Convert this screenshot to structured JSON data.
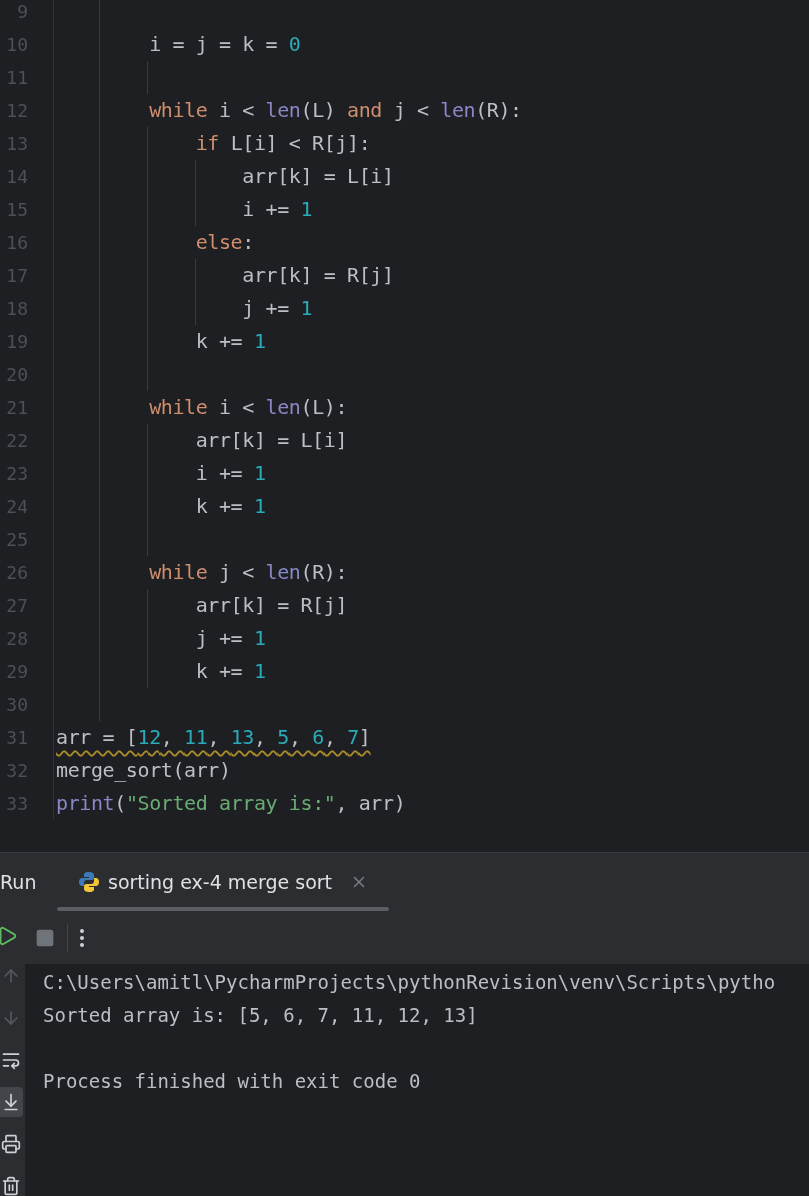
{
  "editor": {
    "lines": [
      {
        "number": "9"
      },
      {
        "number": "10",
        "warning": false,
        "tokens": [
          {
            "kind": "plain",
            "text": "        i = j = k = "
          },
          {
            "kind": "num",
            "text": "0"
          }
        ]
      },
      {
        "number": "11"
      },
      {
        "number": "12",
        "warning": false,
        "tokens": [
          {
            "kind": "kw",
            "text": "        while"
          },
          {
            "kind": "plain",
            "text": " i < "
          },
          {
            "kind": "fn",
            "text": "len"
          },
          {
            "kind": "plain",
            "text": "(L) "
          },
          {
            "kind": "kw",
            "text": "and"
          },
          {
            "kind": "plain",
            "text": " j < "
          },
          {
            "kind": "fn",
            "text": "len"
          },
          {
            "kind": "plain",
            "text": "(R):"
          }
        ]
      },
      {
        "number": "13",
        "warning": false,
        "tokens": [
          {
            "kind": "kw",
            "text": "            if"
          },
          {
            "kind": "plain",
            "text": " L[i] < R[j]:"
          }
        ]
      },
      {
        "number": "14",
        "warning": false,
        "tokens": [
          {
            "kind": "plain",
            "text": "                arr[k] = L[i]"
          }
        ]
      },
      {
        "number": "15",
        "warning": false,
        "tokens": [
          {
            "kind": "plain",
            "text": "                i += "
          },
          {
            "kind": "num",
            "text": "1"
          }
        ]
      },
      {
        "number": "16",
        "warning": false,
        "tokens": [
          {
            "kind": "kw",
            "text": "            else"
          },
          {
            "kind": "plain",
            "text": ":"
          }
        ]
      },
      {
        "number": "17",
        "warning": false,
        "tokens": [
          {
            "kind": "plain",
            "text": "                arr[k] = R[j]"
          }
        ]
      },
      {
        "number": "18",
        "warning": false,
        "tokens": [
          {
            "kind": "plain",
            "text": "                j += "
          },
          {
            "kind": "num",
            "text": "1"
          }
        ]
      },
      {
        "number": "19",
        "warning": false,
        "tokens": [
          {
            "kind": "plain",
            "text": "            k += "
          },
          {
            "kind": "num",
            "text": "1"
          }
        ]
      },
      {
        "number": "20"
      },
      {
        "number": "21",
        "warning": false,
        "tokens": [
          {
            "kind": "kw",
            "text": "        while"
          },
          {
            "kind": "plain",
            "text": " i < "
          },
          {
            "kind": "fn",
            "text": "len"
          },
          {
            "kind": "plain",
            "text": "(L):"
          }
        ]
      },
      {
        "number": "22",
        "warning": false,
        "tokens": [
          {
            "kind": "plain",
            "text": "            arr[k] = L[i]"
          }
        ]
      },
      {
        "number": "23",
        "warning": false,
        "tokens": [
          {
            "kind": "plain",
            "text": "            i += "
          },
          {
            "kind": "num",
            "text": "1"
          }
        ]
      },
      {
        "number": "24",
        "warning": false,
        "tokens": [
          {
            "kind": "plain",
            "text": "            k += "
          },
          {
            "kind": "num",
            "text": "1"
          }
        ]
      },
      {
        "number": "25"
      },
      {
        "number": "26",
        "warning": false,
        "tokens": [
          {
            "kind": "kw",
            "text": "        while"
          },
          {
            "kind": "plain",
            "text": " j < "
          },
          {
            "kind": "fn",
            "text": "len"
          },
          {
            "kind": "plain",
            "text": "(R):"
          }
        ]
      },
      {
        "number": "27",
        "warning": false,
        "tokens": [
          {
            "kind": "plain",
            "text": "            arr[k] = R[j]"
          }
        ]
      },
      {
        "number": "28",
        "warning": false,
        "tokens": [
          {
            "kind": "plain",
            "text": "            j += "
          },
          {
            "kind": "num",
            "text": "1"
          }
        ]
      },
      {
        "number": "29",
        "warning": false,
        "tokens": [
          {
            "kind": "plain",
            "text": "            k += "
          },
          {
            "kind": "num",
            "text": "1"
          }
        ]
      },
      {
        "number": "30"
      },
      {
        "number": "31",
        "warning": true,
        "tokens": [
          {
            "kind": "plain",
            "text": "arr = ["
          },
          {
            "kind": "num",
            "text": "12"
          },
          {
            "kind": "plain",
            "text": ", "
          },
          {
            "kind": "num",
            "text": "11"
          },
          {
            "kind": "plain",
            "text": ", "
          },
          {
            "kind": "num",
            "text": "13"
          },
          {
            "kind": "plain",
            "text": ", "
          },
          {
            "kind": "num",
            "text": "5"
          },
          {
            "kind": "plain",
            "text": ", "
          },
          {
            "kind": "num",
            "text": "6"
          },
          {
            "kind": "plain",
            "text": ", "
          },
          {
            "kind": "num",
            "text": "7"
          },
          {
            "kind": "plain",
            "text": "]"
          }
        ]
      },
      {
        "number": "32",
        "warning": false,
        "tokens": [
          {
            "kind": "plain",
            "text": "merge_sort(arr)"
          }
        ]
      },
      {
        "number": "33",
        "warning": false,
        "tokens": [
          {
            "kind": "fn",
            "text": "print"
          },
          {
            "kind": "plain",
            "text": "("
          },
          {
            "kind": "str",
            "text": "\"Sorted array is:\""
          },
          {
            "kind": "plain",
            "text": ", arr)"
          }
        ]
      }
    ]
  },
  "run_panel": {
    "title": "Run",
    "tabs": [
      {
        "label": "sorting ex-4 merge sort",
        "selected": true
      }
    ],
    "tools": [
      {
        "kind": "up",
        "selected": false,
        "disabled": true
      },
      {
        "kind": "down",
        "selected": false,
        "disabled": true
      },
      {
        "kind": "wrap",
        "selected": false,
        "disabled": false
      },
      {
        "kind": "scroll-end",
        "selected": true,
        "disabled": false
      },
      {
        "kind": "print",
        "selected": false,
        "disabled": false
      },
      {
        "kind": "trash",
        "selected": false,
        "disabled": false
      }
    ],
    "console": [
      {
        "kind": "command",
        "text": "C:\\Users\\amitl\\PycharmProjects\\pythonRevision\\venv\\Scripts\\pytho"
      },
      {
        "kind": "output",
        "text": "Sorted array is: [5, 6, 7, 11, 12, 13]"
      },
      {
        "kind": "exit",
        "text": "Process finished with exit code 0"
      }
    ]
  }
}
